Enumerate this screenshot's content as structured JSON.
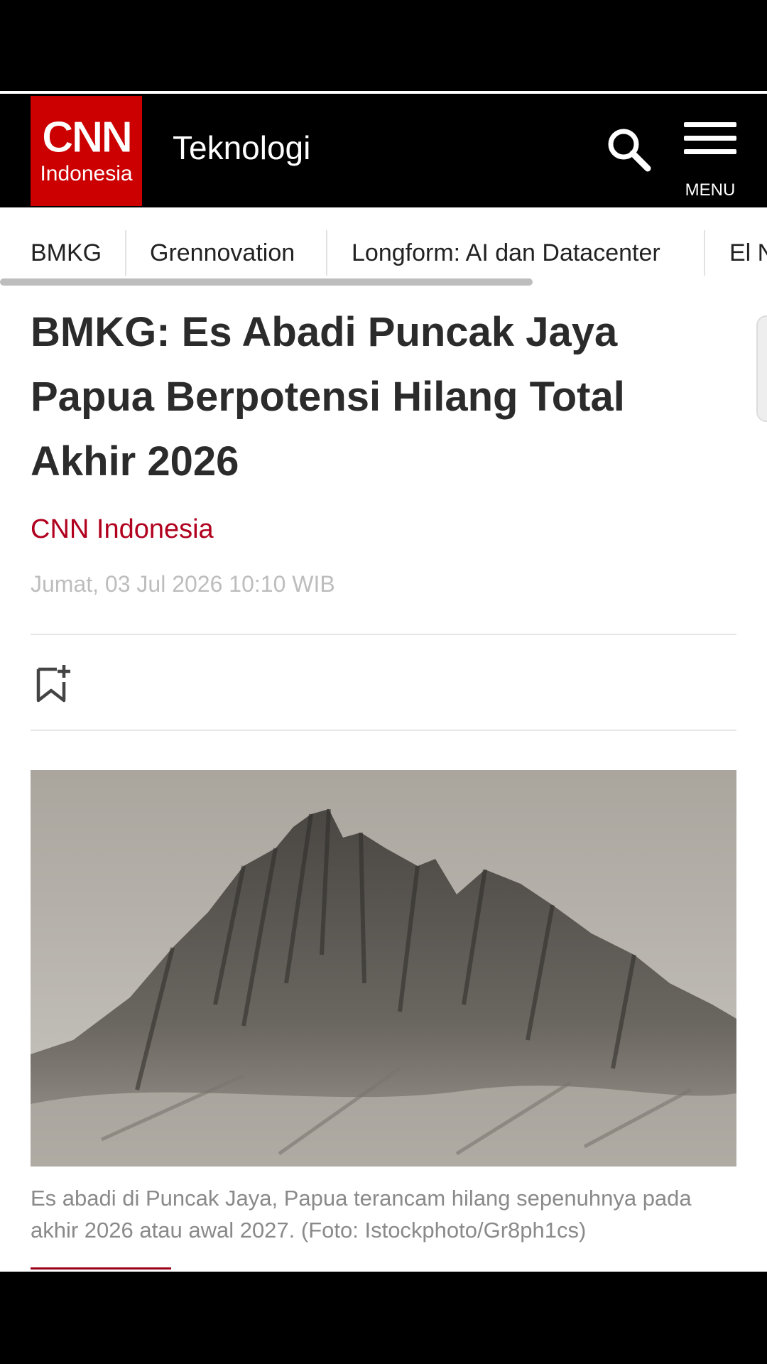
{
  "header": {
    "logo_text": "CNN",
    "logo_subtext": "Indonesia",
    "section_title": "Teknologi",
    "menu_label": "MENU",
    "brand_color": "#cc0000"
  },
  "tabs": [
    {
      "label": "BMKG"
    },
    {
      "label": "Grennovation"
    },
    {
      "label": "Longform: AI dan Datacenter"
    },
    {
      "label": "El Nino"
    }
  ],
  "article": {
    "headline": "BMKG: Es Abadi Puncak Jaya Papua Berpotensi Hilang Total Akhir 2026",
    "author": "CNN Indonesia",
    "date": "Jumat, 03 Jul 2026 10:10 WIB",
    "bookmark_icon": "bookmark-add-icon",
    "image_caption": "Es abadi di Puncak Jaya, Papua terancam hilang sepenuhnya pada akhir 2026 atau awal 2027. (Foto: Istockphoto/Gr8ph1cs)",
    "author_color": "#b0001e"
  }
}
